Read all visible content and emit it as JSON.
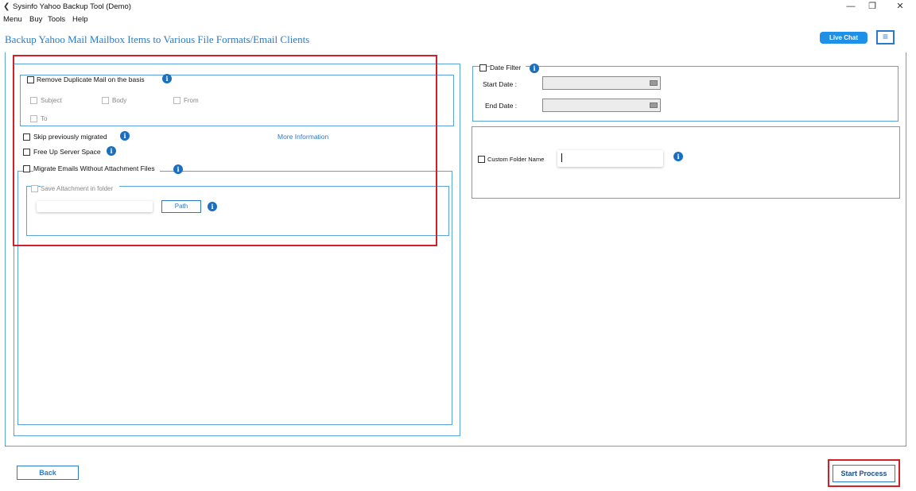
{
  "window": {
    "title": "Sysinfo Yahoo Backup Tool (Demo)",
    "icon": "app-back-arrow-icon",
    "controls": {
      "minimize": "—",
      "maximize": "❐",
      "close": "✕"
    }
  },
  "menu": [
    "Menu",
    "Buy",
    "Tools",
    "Help"
  ],
  "header": {
    "title": "Backup Yahoo Mail Mailbox Items to Various File Formats/Email Clients",
    "live_chat": "Live Chat",
    "hamburger": "≡"
  },
  "left": {
    "dedupe": {
      "label": "Remove Duplicate Mail on the basis",
      "options": [
        "Subject",
        "Body",
        "From",
        "To"
      ]
    },
    "skip_migrated": "Skip previously migrated",
    "more_info": "More Information",
    "free_space": "Free Up Server Space",
    "migrate_without_attach": "Migrate Emails Without Attachment Files",
    "save_attach": "Save Attachment in folder",
    "path_btn": "Path",
    "info_glyph": "i"
  },
  "right": {
    "date_filter": "Date Filter",
    "start_date": "Start Date :",
    "end_date": "End Date :",
    "custom_folder": "Custom Folder Name"
  },
  "footer": {
    "back": "Back",
    "start": "Start Process"
  },
  "colors": {
    "accent": "#2a7ac8",
    "info": "#1a6fc0",
    "highlight": "#d0202a"
  }
}
